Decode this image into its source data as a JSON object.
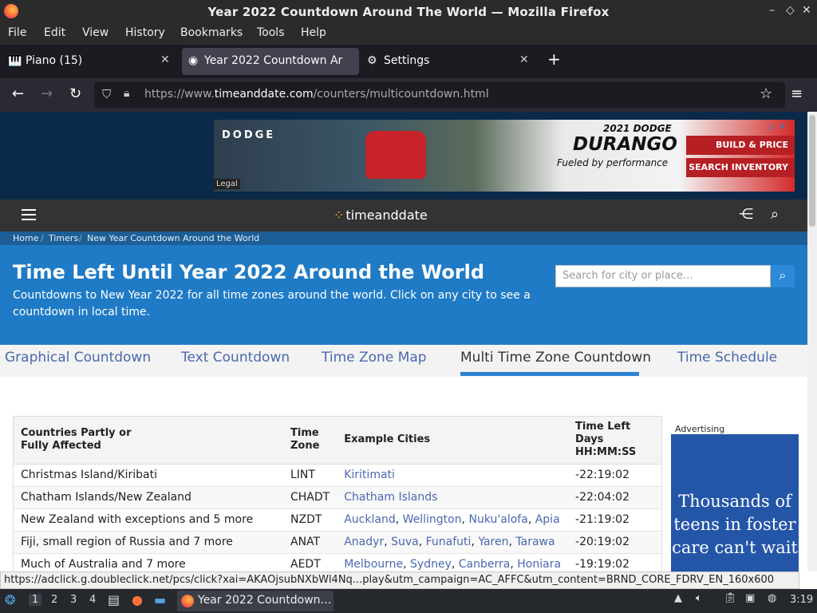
{
  "window": {
    "title": "Year 2022 Countdown Around The World — Mozilla Firefox"
  },
  "menu": [
    "File",
    "Edit",
    "View",
    "History",
    "Bookmarks",
    "Tools",
    "Help"
  ],
  "tabs": [
    {
      "label": "Piano (15)"
    },
    {
      "label": "Year 2022 Countdown Ar"
    },
    {
      "label": "Settings"
    }
  ],
  "urlbar": {
    "prefix": "https://www.",
    "domain": "timeanddate.com",
    "path": "/counters/multicountdown.html"
  },
  "ad_banner": {
    "brand": "DODGE",
    "year": "2021 DODGE",
    "model": "DURANGO",
    "tagline": "Fueled by performance",
    "cta1": "BUILD & PRICE",
    "cta2": "SEARCH INVENTORY",
    "legal": "Legal"
  },
  "site": {
    "logo": "timeanddate"
  },
  "breadcrumbs": [
    "Home",
    "Timers",
    "New Year Countdown Around the World"
  ],
  "hero": {
    "title": "Time Left Until Year 2022 Around the World",
    "description": "Countdowns to New Year 2022 for all time zones around the world. Click on any city to see a countdown in local time.",
    "search_placeholder": "Search for city or place…"
  },
  "page_tabs": [
    "Graphical Countdown",
    "Text Countdown",
    "Time Zone Map",
    "Multi Time Zone Countdown",
    "Time Schedule"
  ],
  "table": {
    "headers": {
      "countries_1": "Countries Partly or",
      "countries_2": "Fully Affected",
      "tz_1": "Time",
      "tz_2": "Zone",
      "cities": "Example Cities",
      "time_1": "Time Left",
      "time_2": "Days",
      "time_3": "HH:MM:SS"
    },
    "rows": [
      {
        "country": "Christmas Island/Kiribati",
        "tz": "LINT",
        "cities": [
          "Kiritimati"
        ],
        "time": "-22:19:02"
      },
      {
        "country": "Chatham Islands/New Zealand",
        "tz": "CHADT",
        "cities": [
          "Chatham Islands"
        ],
        "time": "-22:04:02"
      },
      {
        "country": "New Zealand with exceptions and 5 more",
        "tz": "NZDT",
        "cities": [
          "Auckland",
          "Wellington",
          "Nuku'alofa",
          "Apia"
        ],
        "time": "-21:19:02"
      },
      {
        "country": "Fiji, small region of Russia and 7 more",
        "tz": "ANAT",
        "cities": [
          "Anadyr",
          "Suva",
          "Funafuti",
          "Yaren",
          "Tarawa"
        ],
        "time": "-20:19:02"
      },
      {
        "country": "Much of Australia and 7 more",
        "tz": "AEDT",
        "cities": [
          "Melbourne",
          "Sydney",
          "Canberra",
          "Honiara"
        ],
        "time": "-19:19:02"
      }
    ]
  },
  "side_ad": {
    "label": "Advertising",
    "text": "Thousands of teens in foster care can't wait"
  },
  "status_url": "https://adclick.g.doubleclick.net/pcs/click?xai=AKAOjsubNXbWl4Nq...play&utm_campaign=AC_AFFC&utm_content=BRND_CORE_FDRV_EN_160x600",
  "taskbar": {
    "workspaces": [
      "1",
      "2",
      "3",
      "4"
    ],
    "app": "Year 2022 Countdown…",
    "clock": "3:19"
  }
}
